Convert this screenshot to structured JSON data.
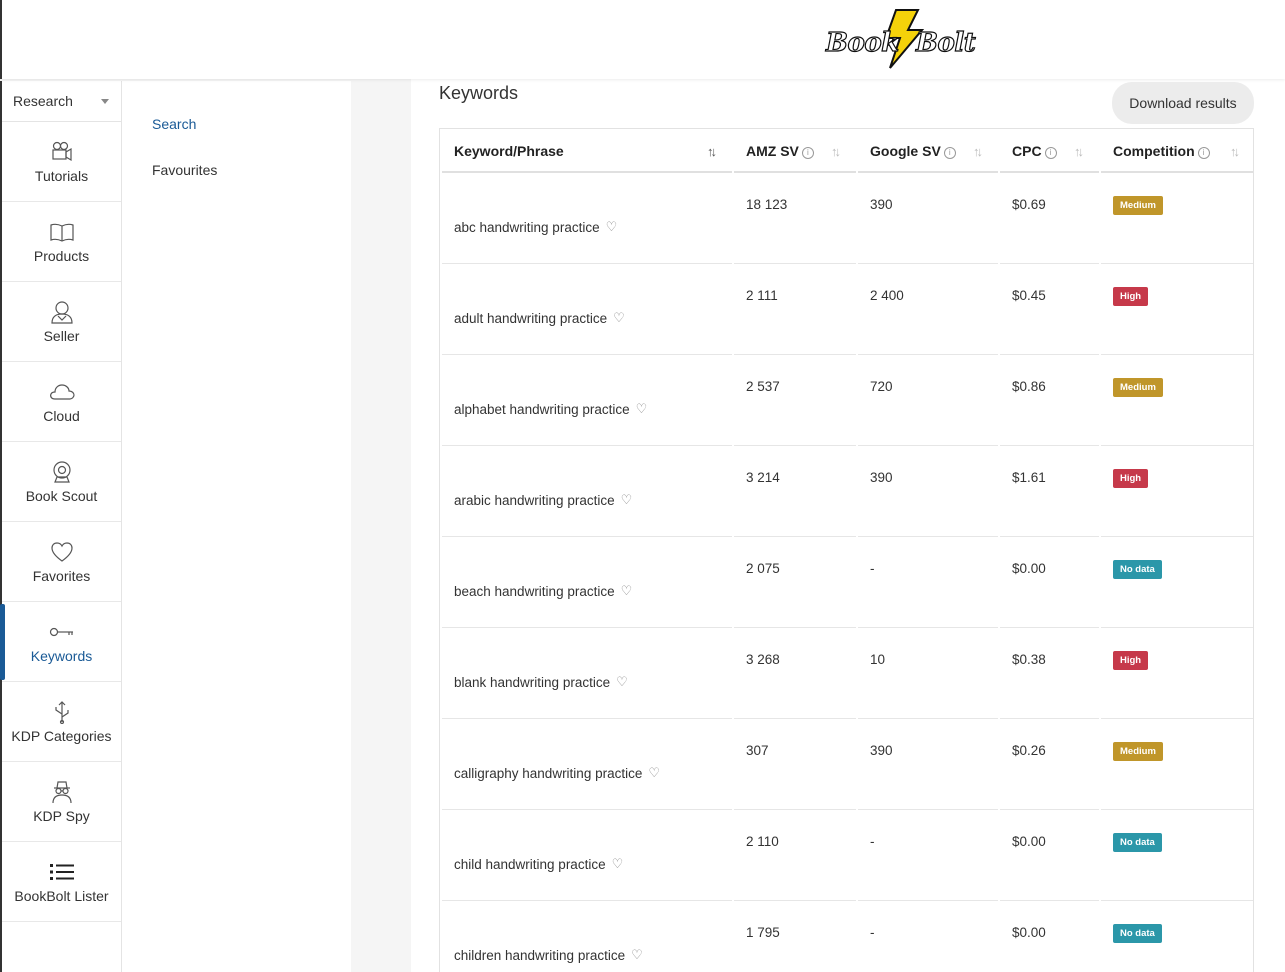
{
  "brand": {
    "logo_text_left": "Book",
    "logo_text_right": "Bolt"
  },
  "sidebar": {
    "section_select": "Research",
    "items": [
      {
        "label": "Tutorials",
        "icon": "video-camera-icon"
      },
      {
        "label": "Products",
        "icon": "open-book-icon"
      },
      {
        "label": "Seller",
        "icon": "user-icon"
      },
      {
        "label": "Cloud",
        "icon": "cloud-icon"
      },
      {
        "label": "Book Scout",
        "icon": "webcam-icon"
      },
      {
        "label": "Favorites",
        "icon": "heart-icon"
      },
      {
        "label": "Keywords",
        "icon": "key-icon",
        "active": true
      },
      {
        "label": "KDP Categories",
        "icon": "usb-icon"
      },
      {
        "label": "KDP Spy",
        "icon": "spy-icon"
      },
      {
        "label": "BookBolt Lister",
        "icon": "list-icon"
      }
    ]
  },
  "subnav": {
    "items": [
      "Search",
      "Favourites"
    ],
    "active": "Search"
  },
  "main": {
    "title": "Keywords",
    "download_label": "Download results",
    "columns": [
      "Keyword/Phrase",
      "AMZ SV",
      "Google SV",
      "CPC",
      "Competition"
    ],
    "rows": [
      {
        "keyword": "abc handwriting practice",
        "amz": "18 123",
        "google": "390",
        "cpc": "$0.69",
        "competition": "Medium"
      },
      {
        "keyword": "adult handwriting practice",
        "amz": "2 111",
        "google": "2 400",
        "cpc": "$0.45",
        "competition": "High"
      },
      {
        "keyword": "alphabet handwriting practice",
        "amz": "2 537",
        "google": "720",
        "cpc": "$0.86",
        "competition": "Medium"
      },
      {
        "keyword": "arabic handwriting practice",
        "amz": "3 214",
        "google": "390",
        "cpc": "$1.61",
        "competition": "High"
      },
      {
        "keyword": "beach handwriting practice",
        "amz": "2 075",
        "google": "-",
        "cpc": "$0.00",
        "competition": "No data"
      },
      {
        "keyword": "blank handwriting practice",
        "amz": "3 268",
        "google": "10",
        "cpc": "$0.38",
        "competition": "High"
      },
      {
        "keyword": "calligraphy handwriting practice",
        "amz": "307",
        "google": "390",
        "cpc": "$0.26",
        "competition": "Medium"
      },
      {
        "keyword": "child handwriting practice",
        "amz": "2 110",
        "google": "-",
        "cpc": "$0.00",
        "competition": "No data"
      },
      {
        "keyword": "children handwriting practice",
        "amz": "1 795",
        "google": "-",
        "cpc": "$0.00",
        "competition": "No data"
      }
    ]
  },
  "colors": {
    "accent": "#1a5a96",
    "medium": "#c0962a",
    "high": "#c6394a",
    "no_data": "#2b97a9",
    "logo_bolt": "#f5d20a"
  }
}
